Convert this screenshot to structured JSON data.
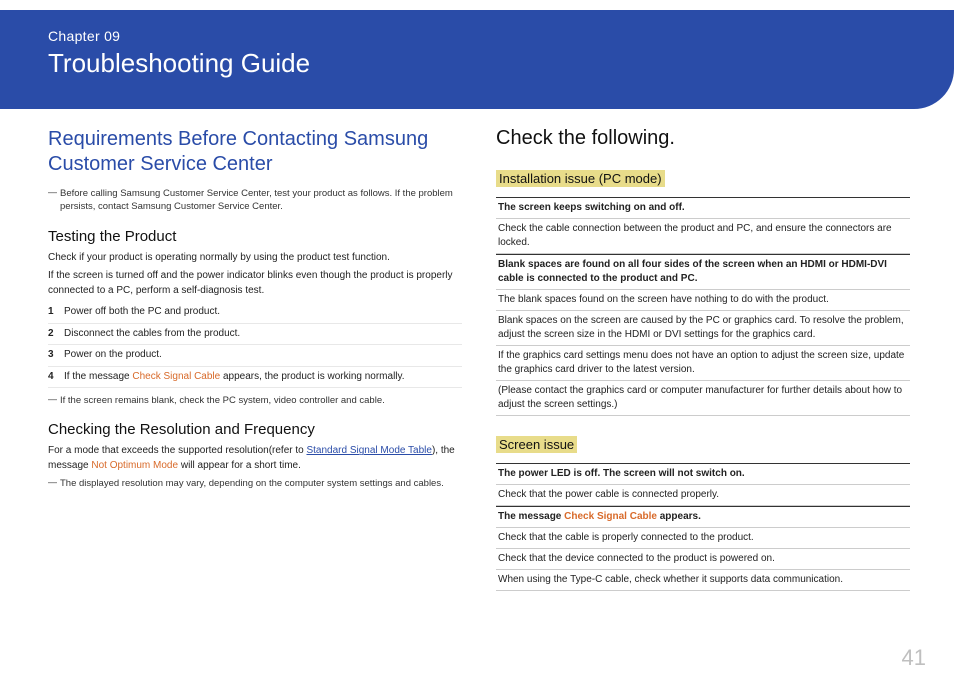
{
  "header": {
    "chapter_label": "Chapter 09",
    "chapter_title": "Troubleshooting Guide"
  },
  "left": {
    "h2": "Requirements Before Contacting Samsung Customer Service Center",
    "note1": "Before calling Samsung Customer Service Center, test your product as follows. If the problem persists, contact Samsung Customer Service Center.",
    "testing_h3": "Testing the Product",
    "testing_p1": "Check if your product is operating normally by using the product test function.",
    "testing_p2": "If the screen is turned off and the power indicator blinks even though the product is properly connected to a PC, perform a self-diagnosis test.",
    "steps": [
      "Power off both the PC and product.",
      "Disconnect the cables from the product.",
      "Power on the product."
    ],
    "step4_pre": "If the message ",
    "step4_msg": "Check Signal Cable",
    "step4_post": " appears, the product is working normally.",
    "note2": "If the screen remains blank, check the PC system, video controller and cable.",
    "resfreq_h3": "Checking the Resolution and Frequency",
    "resfreq_p_pre": "For a mode that exceeds the supported resolution(refer to ",
    "resfreq_link": "Standard Signal Mode Table",
    "resfreq_p_mid": "), the message ",
    "resfreq_msg": "Not Optimum Mode",
    "resfreq_p_post": " will appear for a short time.",
    "note3": "The displayed resolution may vary, depending on the computer system settings and cables."
  },
  "right": {
    "h2": "Check the following.",
    "install_h4": "Installation issue (PC mode)",
    "install_rows": [
      {
        "head": true,
        "text": "The screen keeps switching on and off."
      },
      {
        "head": false,
        "text": "Check the cable connection between the product and PC, and ensure the connectors are locked."
      },
      {
        "head": true,
        "text": "Blank spaces are found on all four sides of the screen when an HDMI or HDMI-DVI cable is connected to the product and PC."
      },
      {
        "head": false,
        "text": "The blank spaces found on the screen have nothing to do with the product."
      },
      {
        "head": false,
        "text": "Blank spaces on the screen are caused by the PC or graphics card. To resolve the problem, adjust the screen size in the HDMI or DVI settings for the graphics card."
      },
      {
        "head": false,
        "text": "If the graphics card settings menu does not have an option to adjust the screen size, update the graphics card driver to the latest version."
      },
      {
        "head": false,
        "text": "(Please contact the graphics card or computer manufacturer for further details about how to adjust the screen settings.)"
      }
    ],
    "screen_h4": "Screen issue",
    "screen_rows": [
      {
        "head": true,
        "text": "The power LED is off. The screen will not switch on."
      },
      {
        "head": false,
        "text": "Check that the power cable is connected properly."
      }
    ],
    "screen_row3_pre": "The message ",
    "screen_row3_msg": "Check Signal Cable",
    "screen_row3_post": " appears.",
    "screen_rows2": [
      {
        "head": false,
        "text": "Check that the cable is properly connected to the product."
      },
      {
        "head": false,
        "text": "Check that the device connected to the product is powered on."
      },
      {
        "head": false,
        "text": "When using the Type-C cable, check whether it supports data communication."
      }
    ]
  },
  "page_number": "41"
}
